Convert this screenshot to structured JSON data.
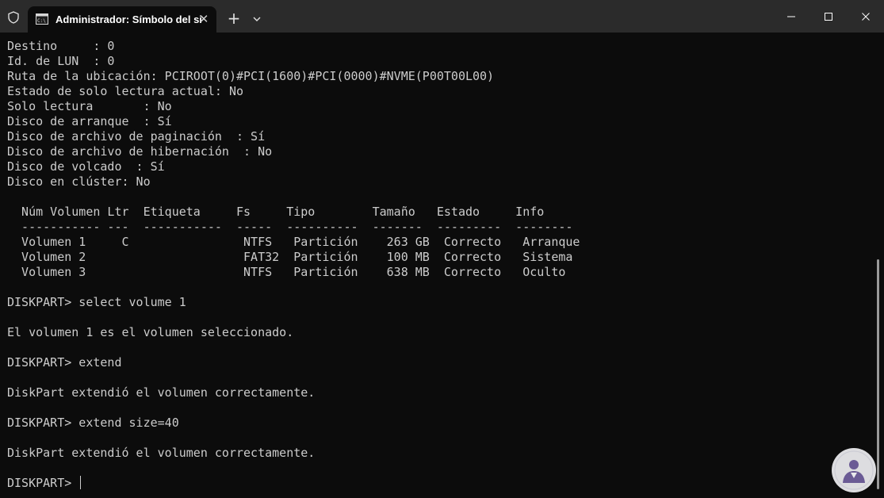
{
  "window": {
    "tab_title": "Administrador: Símbolo del si",
    "icons": {
      "shield": "shield-icon",
      "terminal": "cmd-icon",
      "close_tab": "close-icon",
      "new_tab": "plus-icon",
      "dropdown": "chevron-down-icon",
      "minimize": "minimize-icon",
      "maximize": "maximize-icon",
      "close_window": "close-icon"
    }
  },
  "console": {
    "lines": [
      "Destino     : 0",
      "Id. de LUN  : 0",
      "Ruta de la ubicación: PCIROOT(0)#PCI(1600)#PCI(0000)#NVME(P00T00L00)",
      "Estado de solo lectura actual: No",
      "Solo lectura       : No",
      "Disco de arranque  : Sí",
      "Disco de archivo de paginación  : Sí",
      "Disco de archivo de hibernación  : No",
      "Disco de volcado  : Sí",
      "Disco en clúster: No",
      "",
      "  Núm Volumen Ltr  Etiqueta     Fs     Tipo        Tamaño   Estado     Info",
      "  ----------- ---  -----------  -----  ----------  -------  ---------  --------",
      "  Volumen 1     C                NTFS   Partición    263 GB  Correcto   Arranque",
      "  Volumen 2                      FAT32  Partición    100 MB  Correcto   Sistema",
      "  Volumen 3                      NTFS   Partición    638 MB  Correcto   Oculto",
      "",
      "DISKPART> select volume 1",
      "",
      "El volumen 1 es el volumen seleccionado.",
      "",
      "DISKPART> extend",
      "",
      "DiskPart extendió el volumen correctamente.",
      "",
      "DISKPART> extend size=40",
      "",
      "DiskPart extendió el volumen correctamente.",
      ""
    ],
    "prompt": "DISKPART> ",
    "colors": {
      "background": "#0c0c0c",
      "text": "#cccccc",
      "titlebar": "#2b2b2b"
    }
  }
}
